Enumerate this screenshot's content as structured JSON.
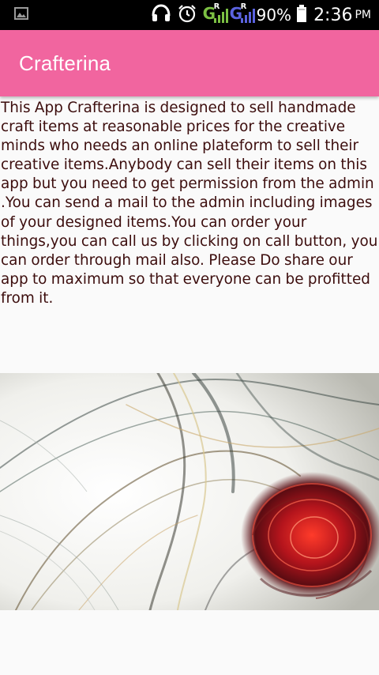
{
  "status_bar": {
    "battery_percent": "90%",
    "time": "2:36",
    "ampm": "PM",
    "signal1_letter": "G",
    "signal1_sup": "R",
    "signal2_letter": "G",
    "signal2_sup": "R",
    "signal1_color": "#7cc043",
    "signal2_color": "#5b63e0",
    "icons": [
      "gallery-icon",
      "headset-icon",
      "alarm-icon",
      "signal-icon",
      "battery-icon"
    ]
  },
  "app_bar": {
    "title": "Crafterina",
    "color": "#f1659f"
  },
  "content": {
    "description": "This App Crafterina is designed to sell handmade craft items at reasonable prices for the creative minds who needs an online plateform to sell their creative items.Anybody can sell their items on this app but you need to get permission from the admin .You can send a mail to the admin including images of your designed items.You can order your things,you can call us by clicking on  call button, you can order through mail also. Please Do share our app to maximum so that everyone can be profitted from it.",
    "text_color": "#3c0d0d"
  }
}
